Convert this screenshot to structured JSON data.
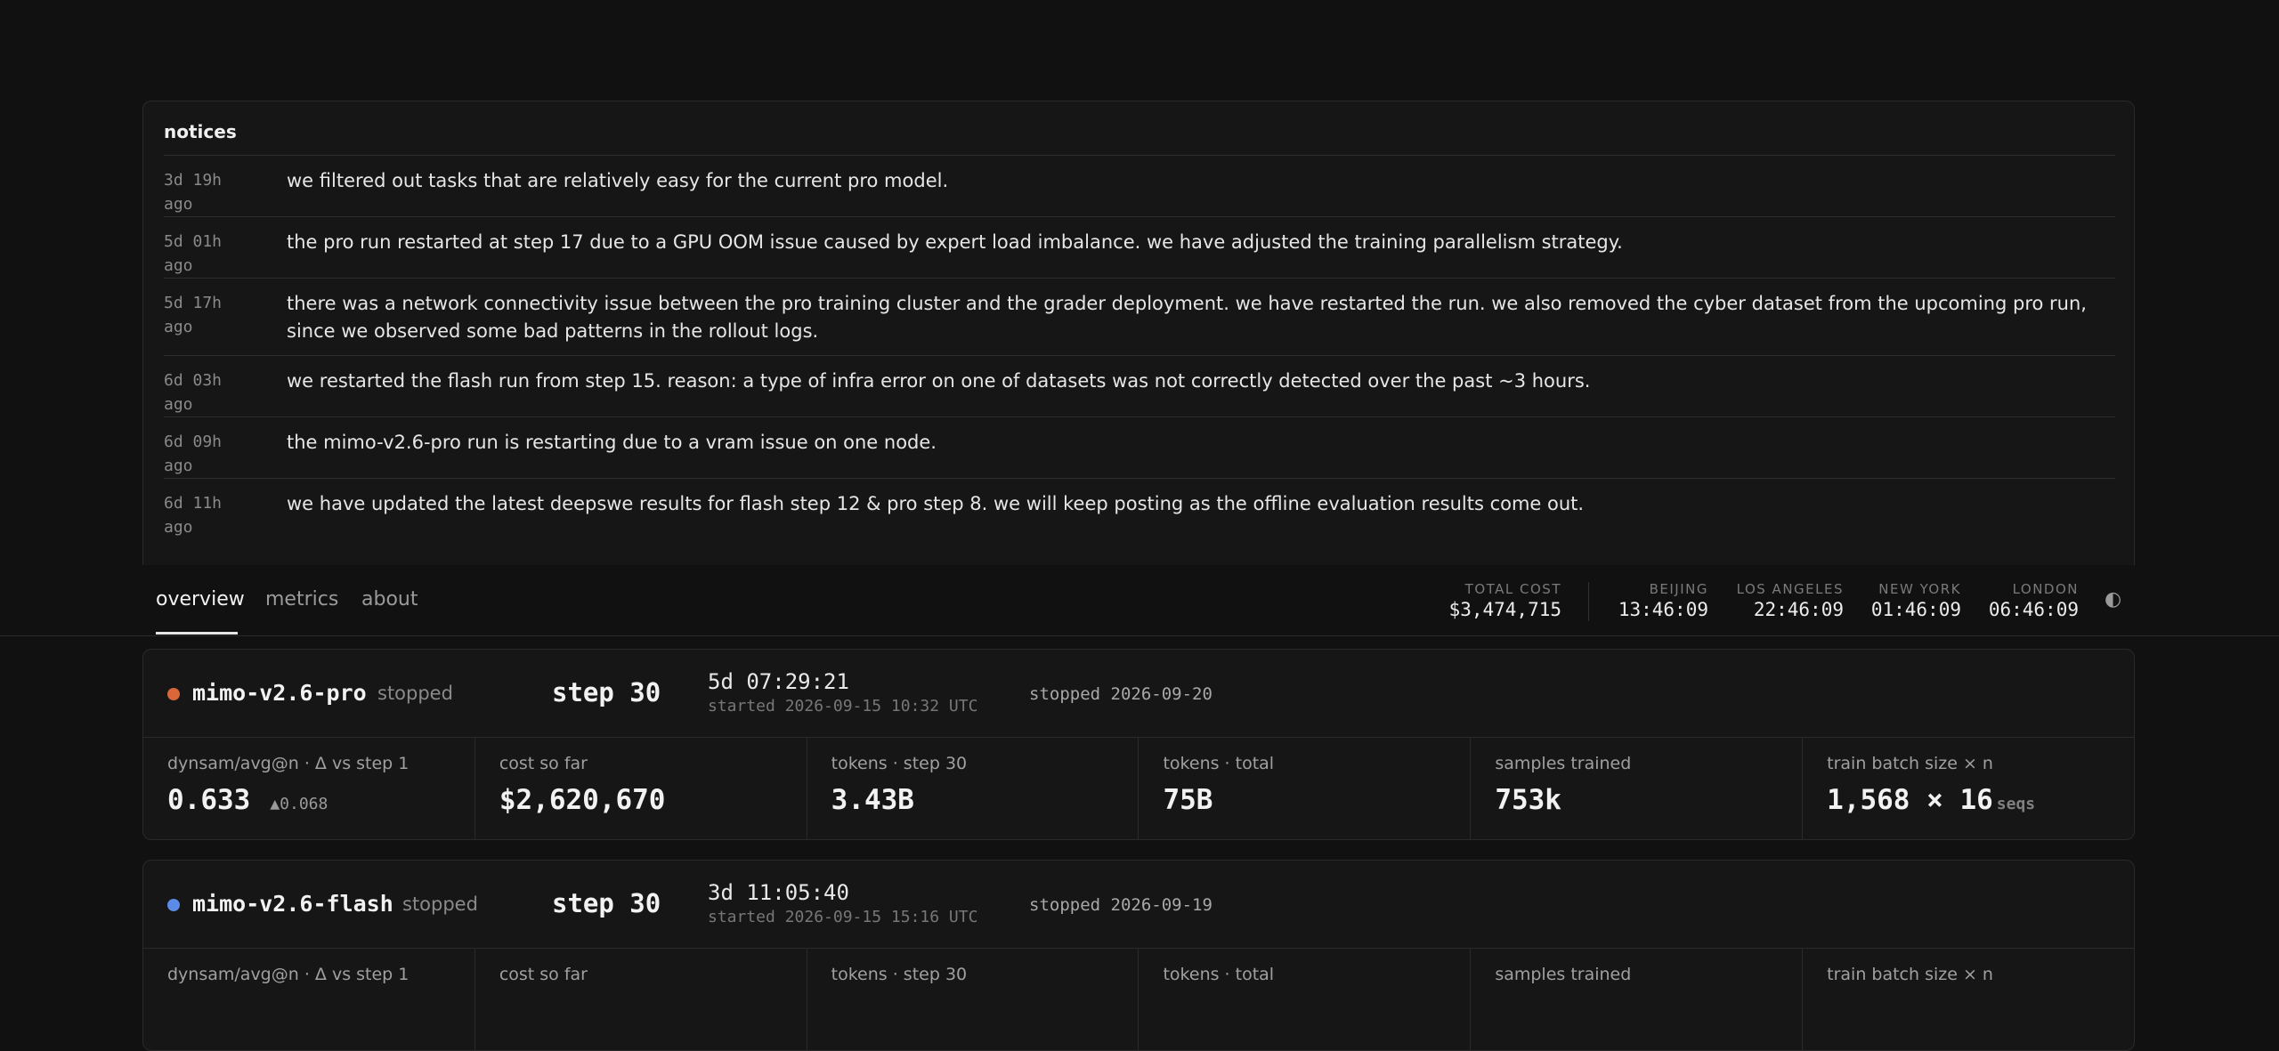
{
  "notices": {
    "title": "notices",
    "items": [
      {
        "time": "3d 19h\nago",
        "text": "we filtered out tasks that are relatively easy for the current pro model."
      },
      {
        "time": "5d 01h\nago",
        "text": "the pro run restarted at step 17 due to a GPU OOM issue caused by expert load imbalance. we have adjusted the training parallelism strategy."
      },
      {
        "time": "5d 17h\nago",
        "text": "there was a network connectivity issue between the pro training cluster and the grader deployment. we have restarted the run. we also removed the cyber dataset from the upcoming pro run, since we observed some bad patterns in the rollout logs."
      },
      {
        "time": "6d 03h\nago",
        "text": "we restarted the flash run from step 15. reason: a type of infra error on one of datasets was not correctly detected over the past ~3 hours."
      },
      {
        "time": "6d 09h\nago",
        "text": "the mimo-v2.6-pro run is restarting due to a vram issue on one node."
      },
      {
        "time": "6d 11h\nago",
        "text": "we have updated the latest deepswe results for flash step 12 & pro step 8. we will keep posting as the offline evaluation results come out."
      }
    ]
  },
  "nav": {
    "tabs": [
      "overview",
      "metrics",
      "about"
    ],
    "active_tab": "overview",
    "total_cost": {
      "label": "TOTAL COST",
      "value": "$3,474,715"
    },
    "clocks": [
      {
        "label": "BEIJING",
        "value": "13:46:09"
      },
      {
        "label": "LOS ANGELES",
        "value": "22:46:09"
      },
      {
        "label": "NEW YORK",
        "value": "01:46:09"
      },
      {
        "label": "LONDON",
        "value": "06:46:09"
      }
    ],
    "theme_toggle": "◐"
  },
  "runs": [
    {
      "name": "mimo-v2.6-pro",
      "status": "stopped",
      "dot_color": "#d9673a",
      "step": "step 30",
      "duration": "5d 07:29:21",
      "started": "started 2026-09-15 10:32 UTC",
      "stopped": "stopped 2026-09-20",
      "stats": [
        {
          "label": "dynsam/avg@n · Δ vs step 1",
          "value": "0.633",
          "delta": "▲0.068"
        },
        {
          "label": "cost so far",
          "value": "$2,620,670"
        },
        {
          "label": "tokens · step 30",
          "value": "3.43B"
        },
        {
          "label": "tokens · total",
          "value": "75B"
        },
        {
          "label": "samples trained",
          "value": "753k"
        },
        {
          "label": "train batch size × n",
          "value": "1,568 × 16",
          "unit": "seqs"
        }
      ]
    },
    {
      "name": "mimo-v2.6-flash",
      "status": "stopped",
      "dot_color": "#5b8be6",
      "step": "step 30",
      "duration": "3d 11:05:40",
      "started": "started 2026-09-15 15:16 UTC",
      "stopped": "stopped 2026-09-19",
      "stats": [
        {
          "label": "dynsam/avg@n · Δ vs step 1"
        },
        {
          "label": "cost so far"
        },
        {
          "label": "tokens · step 30"
        },
        {
          "label": "tokens · total"
        },
        {
          "label": "samples trained"
        },
        {
          "label": "train batch size × n"
        }
      ]
    }
  ]
}
